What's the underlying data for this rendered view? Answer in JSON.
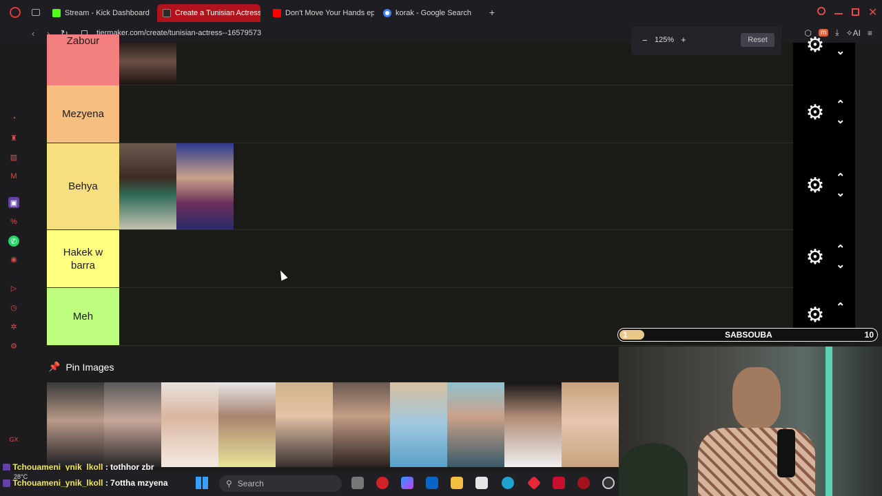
{
  "browser": {
    "tabs": [
      {
        "label": "Stream - Kick Dashboard",
        "active": false
      },
      {
        "label": "Create a Tunisian Actress",
        "active": true
      },
      {
        "label": "Don't Move Your Hands ep",
        "active": false
      },
      {
        "label": "korak - Google Search",
        "active": false
      }
    ],
    "new_tab": "+",
    "url": "tiermaker.com/create/tunisian-actress--16579573"
  },
  "zoom": {
    "minus": "−",
    "value": "125%",
    "plus": "+",
    "reset": "Reset"
  },
  "tiers": [
    {
      "label": "Zabour",
      "color": "#f47f7f"
    },
    {
      "label": "Mezyena",
      "color": "#f7bf7f"
    },
    {
      "label": "Behya",
      "color": "#f7df80"
    },
    {
      "label": "Hakek w barra",
      "color": "#fefe7f"
    },
    {
      "label": "Meh",
      "color": "#bfff7f"
    }
  ],
  "controls": {
    "gear": "⚙",
    "up": "⌃",
    "down": "⌄"
  },
  "pin": {
    "title": "Pin Images",
    "icon": "pin-icon"
  },
  "slider": {
    "min": "1",
    "label": "SABSOUBA",
    "max": "10",
    "value": 1
  },
  "chat": [
    {
      "user": "Tchouameni_ynik_lkoll",
      "message": ": tothhor zbr"
    },
    {
      "user": "Tchouameni_ynik_lkoll",
      "message": ": 7ottha mzyena"
    }
  ],
  "taskbar": {
    "search": "Search",
    "weather": "28°C"
  }
}
